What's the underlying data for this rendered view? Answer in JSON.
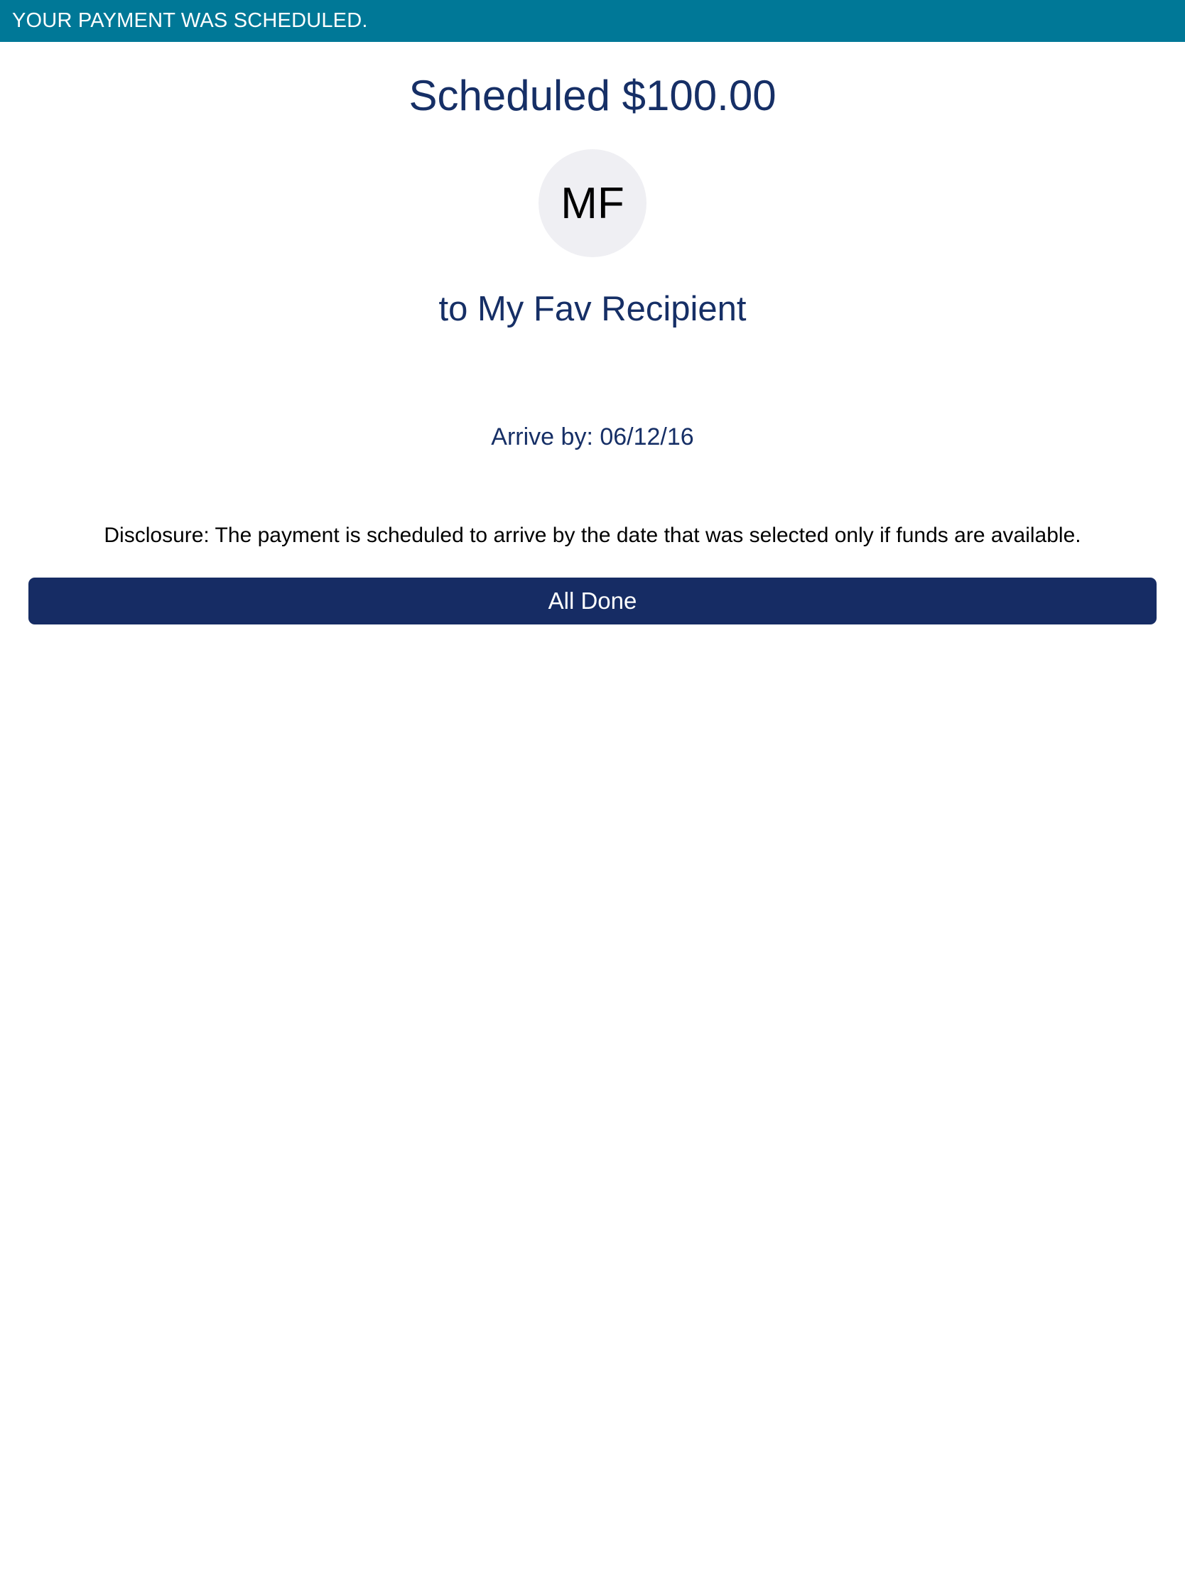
{
  "banner": {
    "text": "YOUR PAYMENT WAS SCHEDULED."
  },
  "payment": {
    "title": "Scheduled $100.00",
    "recipient_initials": "MF",
    "recipient_line": "to My Fav Recipient",
    "arrive_by": "Arrive by: 06/12/16",
    "disclosure": "Disclosure: The payment is scheduled to arrive by the date that was selected only if funds are available."
  },
  "actions": {
    "done_label": "All Done"
  },
  "colors": {
    "banner_bg": "#007897",
    "primary_text": "#162f66",
    "button_bg": "#162c64",
    "avatar_bg": "#efeff3"
  }
}
